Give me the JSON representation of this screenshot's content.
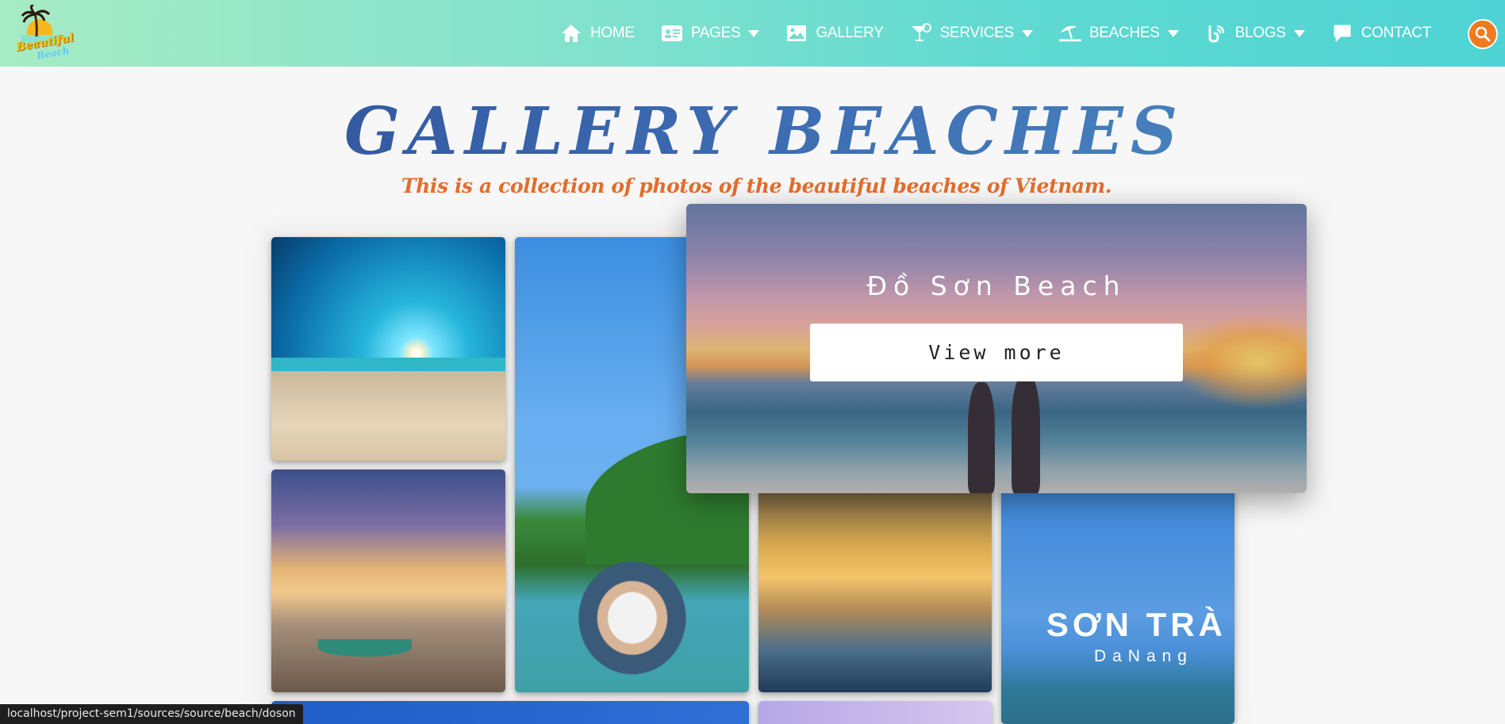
{
  "logo": {
    "title": "Beautiful",
    "subtitle": "Beach"
  },
  "nav": {
    "items": [
      {
        "label": "HOME",
        "icon": "home-icon"
      },
      {
        "label": "PAGES",
        "icon": "id-card-icon",
        "dropdown": true
      },
      {
        "label": "GALLERY",
        "icon": "image-icon"
      },
      {
        "label": "SERVICES",
        "icon": "cocktail-icon",
        "dropdown": true
      },
      {
        "label": "BEACHES",
        "icon": "umbrella-beach-icon",
        "dropdown": true
      },
      {
        "label": "BLOGS",
        "icon": "blog-icon",
        "dropdown": true
      },
      {
        "label": "CONTACT",
        "icon": "comment-icon"
      }
    ],
    "search_icon": "search-icon"
  },
  "header": {
    "title": "GALLERY BEACHES",
    "subtitle": "This is a collection of photos of the beautiful beaches of Vietnam."
  },
  "gallery": {
    "featured": {
      "title": "Đồ Sơn Beach",
      "button": "View more"
    },
    "son_tra": {
      "title": "SƠN TRÀ",
      "subtitle": "DaNang"
    }
  },
  "status_bar": {
    "url": "localhost/project-sem1/sources/source/beach/doson"
  },
  "colors": {
    "nav_gradient_start": "#a6ebc4",
    "nav_gradient_end": "#4fd3d4",
    "search_button": "#f07a1e",
    "title_blue": "#2c4b94",
    "subtitle_orange": "#e46d2b"
  }
}
